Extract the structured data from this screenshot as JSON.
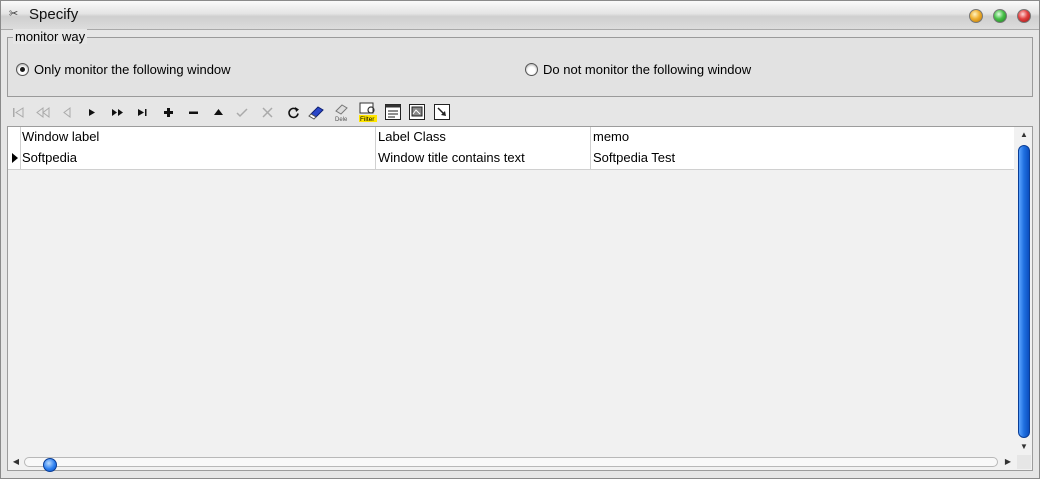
{
  "window": {
    "title": "Specify",
    "app_icon": "scissors-icon"
  },
  "monitor_way": {
    "legend": "monitor way",
    "options": [
      {
        "label": "Only monitor the following window",
        "selected": true
      },
      {
        "label": "Do not monitor the following window",
        "selected": false
      }
    ]
  },
  "toolbar": {
    "buttons": [
      {
        "name": "first-record",
        "glyph": "|◁",
        "enabled": false
      },
      {
        "name": "prior-page",
        "glyph": "◁◁",
        "enabled": false
      },
      {
        "name": "prior-record",
        "glyph": "◁",
        "enabled": false
      },
      {
        "name": "next-record",
        "glyph": "▶",
        "enabled": true
      },
      {
        "name": "next-page",
        "glyph": "▶▶",
        "enabled": true
      },
      {
        "name": "last-record",
        "glyph": "▶|",
        "enabled": true
      },
      {
        "name": "insert",
        "glyph": "+",
        "enabled": true
      },
      {
        "name": "delete",
        "glyph": "−",
        "enabled": true
      },
      {
        "name": "edit",
        "glyph": "▲",
        "enabled": true
      },
      {
        "name": "post",
        "glyph": "✓",
        "enabled": false
      },
      {
        "name": "cancel",
        "glyph": "✕",
        "enabled": false
      },
      {
        "name": "refresh",
        "glyph": "↻",
        "enabled": true
      },
      {
        "name": "eraser",
        "glyph": "",
        "enabled": true
      },
      {
        "name": "dele",
        "glyph": "Dele",
        "enabled": true
      },
      {
        "name": "filter",
        "glyph": "Filter",
        "enabled": true
      },
      {
        "name": "report",
        "glyph": "",
        "enabled": true
      },
      {
        "name": "export",
        "glyph": "",
        "enabled": true
      },
      {
        "name": "import",
        "glyph": "",
        "enabled": true
      }
    ]
  },
  "grid": {
    "columns": [
      "Window label",
      "Label Class",
      "memo"
    ],
    "rows": [
      [
        "Softpedia",
        "Window title contains text",
        "Softpedia Test"
      ]
    ]
  },
  "colors": {
    "scroll_accent": "#1f6fe0"
  }
}
